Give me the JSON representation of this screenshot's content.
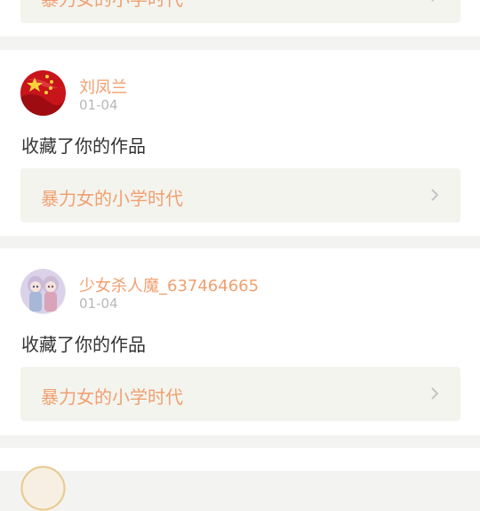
{
  "feed": {
    "items": [
      {
        "user": "",
        "time": "",
        "action": "",
        "work_title": "暴力女的小学时代"
      },
      {
        "user": "刘凤兰",
        "time": "01-04",
        "action": "收藏了你的作品",
        "work_title": "暴力女的小学时代"
      },
      {
        "user": "少女杀人魔_637464665",
        "time": "01-04",
        "action": "收藏了你的作品",
        "work_title": "暴力女的小学时代"
      }
    ]
  },
  "colors": {
    "accent": "#f0a070",
    "muted": "#b8b8b8",
    "text": "#333333",
    "card_bg": "#ffffff",
    "page_bg": "#f3f3f1",
    "work_bg": "#f4f4ef"
  },
  "icons": {
    "chevron": "chevron-right-icon"
  }
}
